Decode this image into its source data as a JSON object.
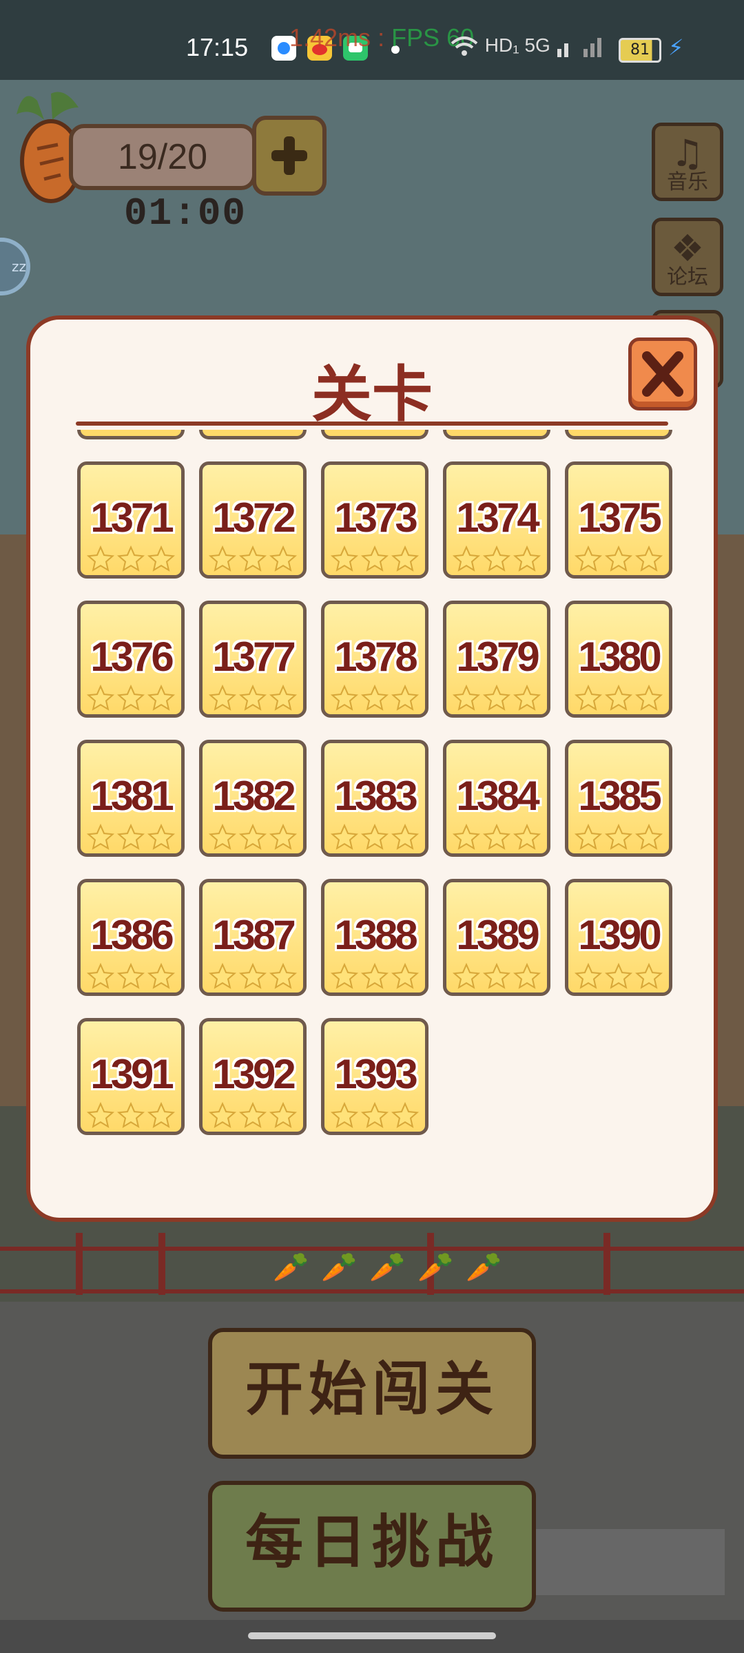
{
  "status_bar": {
    "time": "17:15",
    "fps_overlay_ms": "1.42ms",
    "fps_overlay_label": "FPS 60",
    "network": "HD₁ 5G",
    "battery": "81"
  },
  "hud": {
    "stamina": "19/20",
    "timer": "01:00",
    "music_label": "音乐",
    "forum_label": "论坛"
  },
  "modal": {
    "title": "关卡",
    "levels": [
      "1371",
      "1372",
      "1373",
      "1374",
      "1375",
      "1376",
      "1377",
      "1378",
      "1379",
      "1380",
      "1381",
      "1382",
      "1383",
      "1384",
      "1385",
      "1386",
      "1387",
      "1388",
      "1389",
      "1390",
      "1391",
      "1392",
      "1393"
    ]
  },
  "buttons": {
    "start": "开始闯关",
    "daily": "每日挑战"
  },
  "colors": {
    "modal_border": "#8c3a26",
    "card_fill": "#ffd969",
    "level_text": "#7a1f1a",
    "close_button": "#f08a4c"
  }
}
